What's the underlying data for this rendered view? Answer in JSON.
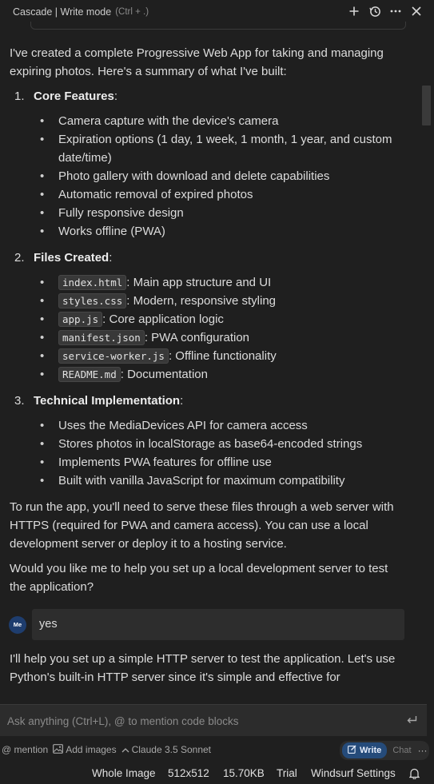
{
  "titlebar": {
    "title": "Cascade | Write mode",
    "shortcut": "(Ctrl + .)"
  },
  "message1": {
    "intro": "I've created a complete Progressive Web App for taking and managing expiring photos. Here's a summary of what I've built:",
    "sections": [
      {
        "num": "1.",
        "heading": "Core Features",
        "items": [
          "Camera capture with the device's camera",
          "Expiration options (1 day, 1 week, 1 month, 1 year, and custom date/time)",
          "Photo gallery with download and delete capabilities",
          "Automatic removal of expired photos",
          "Fully responsive design",
          "Works offline (PWA)"
        ]
      },
      {
        "num": "2.",
        "heading": "Files Created",
        "files": [
          {
            "name": "index.html",
            "desc": ": Main app structure and UI"
          },
          {
            "name": "styles.css",
            "desc": ": Modern, responsive styling"
          },
          {
            "name": "app.js",
            "desc": ": Core application logic"
          },
          {
            "name": "manifest.json",
            "desc": ": PWA configuration"
          },
          {
            "name": "service-worker.js",
            "desc": ": Offline functionality"
          },
          {
            "name": "README.md",
            "desc": ": Documentation"
          }
        ]
      },
      {
        "num": "3.",
        "heading": "Technical Implementation",
        "items": [
          "Uses the MediaDevices API for camera access",
          "Stores photos in localStorage as base64-encoded strings",
          "Implements PWA features for offline use",
          "Built with vanilla JavaScript for maximum compatibility"
        ]
      }
    ],
    "paragraph1": "To run the app, you'll need to serve these files through a web server with HTTPS (required for PWA and camera access). You can use a local development server or deploy it to a hosting service.",
    "paragraph2": "Would you like me to help you set up a local development server to test the application?"
  },
  "user_message": {
    "avatar": "Me",
    "text": "yes"
  },
  "message2": {
    "text": "I'll help you set up a simple HTTP server to test the application. Let's use Python's built-in HTTP server since it's simple and effective for"
  },
  "input": {
    "placeholder": "Ask anything (Ctrl+L), @ to mention code blocks"
  },
  "toolbar": {
    "mention": "@ mention",
    "add_images": "Add images",
    "model": "Claude 3.5 Sonnet",
    "write": "Write",
    "chat": "Chat",
    "more": "···"
  },
  "statusbar": {
    "whole_image": "Whole Image",
    "dimensions": "512x512",
    "size": "15.70KB",
    "trial": "Trial",
    "settings": "Windsurf Settings"
  }
}
